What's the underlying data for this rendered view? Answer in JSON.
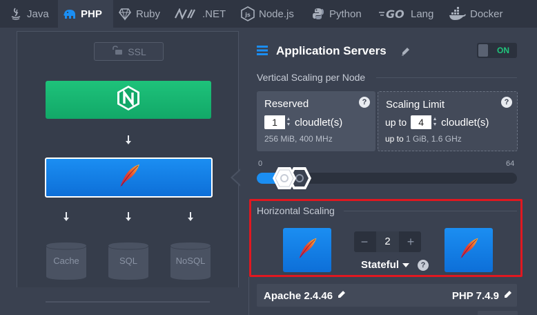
{
  "tabs": [
    {
      "label": "Java",
      "icon": "java-icon",
      "active": false
    },
    {
      "label": "PHP",
      "icon": "php-elephant-icon",
      "active": true
    },
    {
      "label": "Ruby",
      "icon": "ruby-icon",
      "active": false
    },
    {
      "label": ".NET",
      "icon": "dotnet-icon",
      "active": false
    },
    {
      "label": "Node.js",
      "icon": "nodejs-icon",
      "active": false
    },
    {
      "label": "Python",
      "icon": "python-icon",
      "active": false
    },
    {
      "label": "Lang",
      "icon": "go-icon",
      "active": false
    },
    {
      "label": "Docker",
      "icon": "docker-icon",
      "active": false
    }
  ],
  "tab_go_text": "GO",
  "topology": {
    "ssl_label": "SSL",
    "databases": [
      {
        "label": "Cache"
      },
      {
        "label": "SQL"
      },
      {
        "label": "NoSQL"
      }
    ]
  },
  "app_servers": {
    "title": "Application Servers",
    "toggle_label": "ON",
    "vertical_scaling": {
      "label": "Vertical Scaling per Node",
      "reserved": {
        "title": "Reserved",
        "value": "1",
        "unit": "cloudlet(s)",
        "info": "256 MiB, 400 MHz"
      },
      "limit": {
        "title": "Scaling Limit",
        "prefix": "up to",
        "value": "4",
        "unit": "cloudlet(s)",
        "info_prefix": "up to",
        "info": "1 GiB, 1.6 GHz"
      },
      "slider": {
        "min": "0",
        "max": "64",
        "reserved_value": 1,
        "limit_value": 4
      }
    },
    "horizontal_scaling": {
      "label": "Horizontal Scaling",
      "count": "2",
      "minus": "−",
      "plus": "+",
      "mode": "Stateful"
    },
    "stack": {
      "server": "Apache 2.4.46",
      "engine": "PHP 7.4.9"
    }
  },
  "colors": {
    "accent_blue": "#1b8ef2",
    "nginx_green": "#1ec27a",
    "highlight_red": "#e01820",
    "toggle_on": "#20c47c"
  },
  "help_glyph": "?"
}
